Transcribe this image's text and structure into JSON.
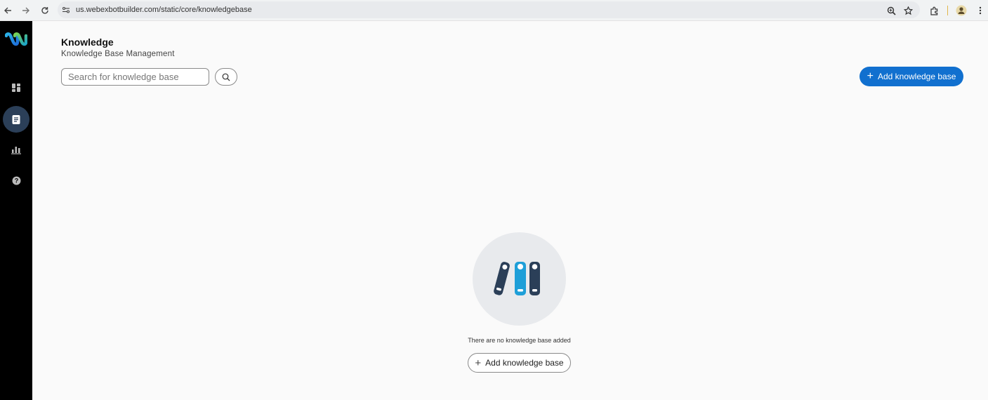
{
  "browser": {
    "url": "us.webexbotbuilder.com/static/core/knowledgebase",
    "icons": [
      "back-arrow-icon",
      "forward-arrow-icon",
      "reload-icon",
      "site-settings-icon",
      "zoom-icon",
      "bookmark-star-icon",
      "extensions-icon",
      "profile-icon",
      "menu-kebab-icon"
    ]
  },
  "sidebar": {
    "items": [
      {
        "icon": "webex-logo-icon"
      },
      {
        "icon": "dashboard-icon"
      },
      {
        "icon": "knowledge-document-icon",
        "active": true
      },
      {
        "icon": "analytics-chart-icon"
      },
      {
        "icon": "help-icon"
      }
    ]
  },
  "header": {
    "title": "Knowledge",
    "subtitle": "Knowledge Base Management"
  },
  "search": {
    "placeholder": "Search for knowledge base"
  },
  "actions": {
    "add_label": "Add knowledge base"
  },
  "empty_state": {
    "message": "There are no knowledge base added",
    "add_label": "Add knowledge base",
    "icon": "binders-icon"
  },
  "colors": {
    "accent": "#1170cf",
    "sidebar_bg": "#000000",
    "active_item_bg": "#2b3f58"
  }
}
